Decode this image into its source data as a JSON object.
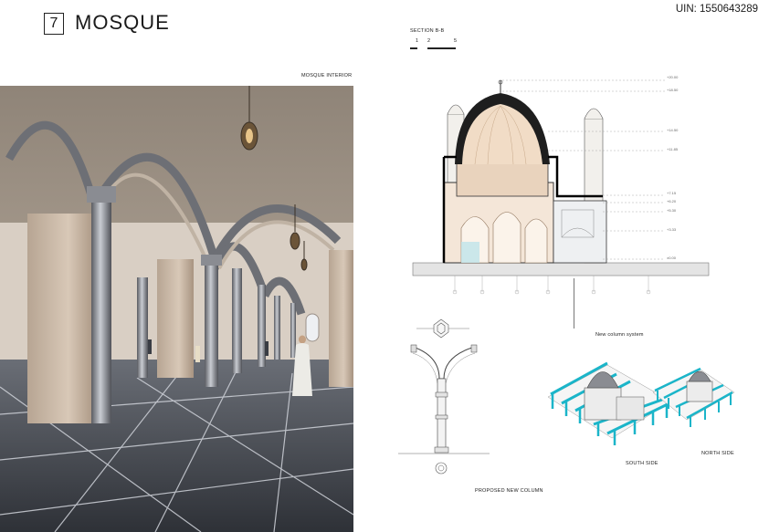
{
  "header": {
    "number": "7",
    "title": "MOSQUE",
    "uin": "UIN: 1550643289"
  },
  "interior": {
    "caption": "MOSQUE INTERIOR"
  },
  "section": {
    "title": "SECTION B-B",
    "scale_labels": [
      "1",
      "2",
      "5"
    ],
    "levels": [
      "+20.00",
      "+18.50",
      "+14.50",
      "+11.85",
      "+7.15",
      "+6.20",
      "+5.30",
      "+3.33",
      "±0.00"
    ]
  },
  "column": {
    "caption": "PROPOSED NEW COLUMN"
  },
  "axo": {
    "new_column_label": "New column system",
    "north_label": "NORTH SIDE",
    "south_label": "SOUTH SIDE",
    "accent_color": "#1bb5c9"
  }
}
